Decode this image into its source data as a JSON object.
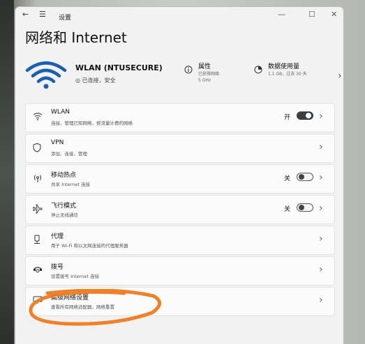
{
  "window": {
    "title": "设置",
    "back_glyph": "←",
    "menu_glyph": "☰",
    "minimize_glyph": "—",
    "maximize_glyph": "☐",
    "close_glyph": "✕"
  },
  "page_title": "网络和 Internet",
  "connection": {
    "ssid": "WLAN (NTUSECURE)",
    "status": "◎ 已连接，安全",
    "properties": {
      "label": "属性",
      "line1": "已获得网络",
      "line2": "5 GHz"
    },
    "usage": {
      "label": "数据使用量",
      "line1": "1.1 GB，过去 30 天"
    },
    "chevron": "›"
  },
  "settings": [
    {
      "title": "WLAN",
      "desc": "连接，管理已知网络，按流量计费的网络",
      "toggle_label": "开",
      "toggle": "on",
      "icon": "wifi-icon"
    },
    {
      "title": "VPN",
      "desc": "添加、连接、管理",
      "icon": "shield-icon"
    },
    {
      "title": "移动热点",
      "desc": "共享 Internet 连接",
      "toggle_label": "关",
      "toggle": "off",
      "icon": "hotspot-icon"
    },
    {
      "title": "飞行模式",
      "desc": "停止无线通信",
      "toggle_label": "关",
      "toggle": "off",
      "icon": "airplane-icon"
    },
    {
      "title": "代理",
      "desc": "用于 Wi-Fi 和以太网连接的代理服务器",
      "icon": "proxy-icon"
    },
    {
      "title": "拨号",
      "desc": "设置拨号 Internet 连接",
      "icon": "dialup-icon"
    },
    {
      "title": "高级网络设置",
      "desc": "查看所有网络适配器，网络重置",
      "icon": "network-adapter-icon"
    }
  ],
  "chevron": "›",
  "colors": {
    "accent": "#1a5fb4",
    "scribble": "#f07a1e",
    "toggle_on": "#3a3f44"
  }
}
